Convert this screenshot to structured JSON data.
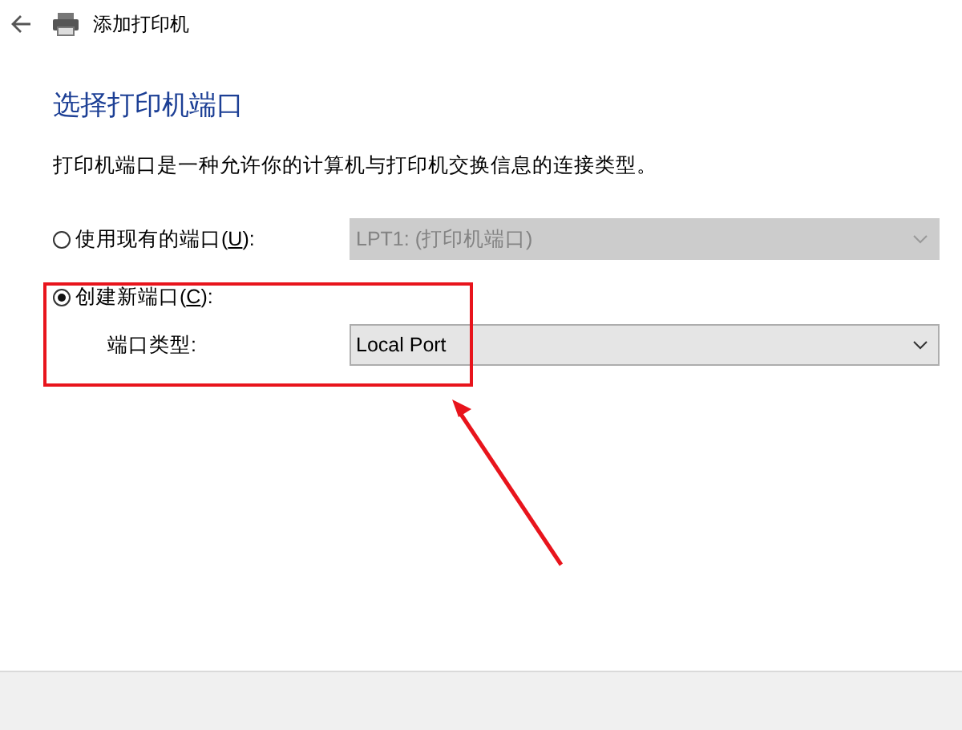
{
  "window": {
    "title": "添加打印机"
  },
  "heading": "选择打印机端口",
  "description": "打印机端口是一种允许你的计算机与打印机交换信息的连接类型。",
  "options": [
    {
      "label": "使用现有的端口(",
      "access_key": "U",
      "label_end": "):",
      "selected": false,
      "dropdown": {
        "value": "LPT1: (打印机端口)",
        "disabled": true
      }
    },
    {
      "label": "创建新端口(",
      "access_key": "C",
      "label_end": "):",
      "selected": true,
      "sub_label": "端口类型:",
      "dropdown": {
        "value": "Local Port",
        "disabled": false
      }
    }
  ]
}
